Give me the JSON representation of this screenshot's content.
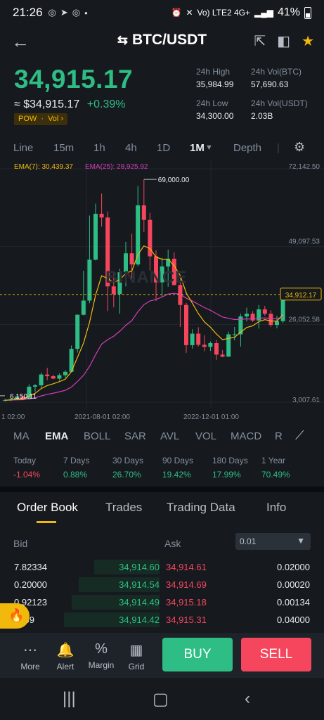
{
  "status_bar": {
    "time": "21:26",
    "battery": "41%",
    "network": "Vo) LTE2 4G+"
  },
  "header": {
    "pair": "BTC/USDT"
  },
  "ticker": {
    "last_price": "34,915.17",
    "approx": "≈ $34,915.17",
    "change": "+0.39%",
    "tag": "POW",
    "tag_vol": "Vol",
    "high_label": "24h High",
    "high_value": "35,984.99",
    "vol_btc_label": "24h Vol(BTC)",
    "vol_btc_value": "57,690.63",
    "low_label": "24h Low",
    "low_value": "34,300.00",
    "vol_usdt_label": "24h Vol(USDT)",
    "vol_usdt_value": "2.03B"
  },
  "intervals": [
    "Line",
    "15m",
    "1h",
    "4h",
    "1D",
    "1M",
    "Depth"
  ],
  "active_interval": "1M",
  "chart_data": {
    "type": "candlestick",
    "ema7_label": "EMA(7): 30,439.37",
    "ema25_label": "EMA(25): 28,925.92",
    "y_ticks": [
      "72,142.50",
      "49,097.53",
      "26,052.58",
      "3,007.61"
    ],
    "y_tick_values": [
      72142.5,
      49097.53,
      26052.58,
      3007.61
    ],
    "current_price_label": "34,912.17",
    "current_price_value": 34912.17,
    "max_label": "69,000.00",
    "max_value": 69000,
    "min_label": "6,150.11",
    "min_value": 6150.11,
    "x_labels": [
      "1 02:00",
      "2021-08-01 02:00",
      "2022-12-01 01:00"
    ],
    "watermark": "BINANCE",
    "candles": [
      [
        3500,
        3900,
        3300,
        3600
      ],
      [
        3600,
        4200,
        3400,
        3900
      ],
      [
        3900,
        5000,
        3600,
        4700
      ],
      [
        4700,
        4900,
        3700,
        3900
      ],
      [
        3900,
        8300,
        3800,
        7600
      ],
      [
        7600,
        8400,
        6150,
        8000
      ],
      [
        8000,
        11800,
        7200,
        11200
      ],
      [
        11200,
        13200,
        9500,
        10700
      ],
      [
        10700,
        11100,
        9800,
        10000
      ],
      [
        10000,
        11500,
        9400,
        11000
      ],
      [
        11000,
        12500,
        10200,
        12000
      ],
      [
        12000,
        19800,
        11900,
        18800
      ],
      [
        18800,
        29000,
        17700,
        28900
      ],
      [
        28900,
        41900,
        28700,
        33100
      ],
      [
        33100,
        58300,
        32300,
        45200
      ],
      [
        45200,
        61800,
        45000,
        58800
      ],
      [
        58800,
        64800,
        55000,
        57700
      ],
      [
        57700,
        59500,
        30000,
        37300
      ],
      [
        37300,
        41300,
        31100,
        35000
      ],
      [
        35000,
        42500,
        29200,
        41500
      ],
      [
        41500,
        50500,
        37300,
        47100
      ],
      [
        47100,
        52900,
        39600,
        43800
      ],
      [
        43800,
        67000,
        43300,
        61300
      ],
      [
        61300,
        69000,
        53400,
        57000
      ],
      [
        57000,
        59100,
        42000,
        46200
      ],
      [
        46200,
        48000,
        33000,
        38500
      ],
      [
        38500,
        45800,
        34300,
        43200
      ],
      [
        43200,
        48200,
        37200,
        45500
      ],
      [
        45500,
        47400,
        37600,
        37700
      ],
      [
        37700,
        40000,
        25300,
        31800
      ],
      [
        31800,
        32400,
        17600,
        19900
      ],
      [
        19900,
        24600,
        18900,
        23300
      ],
      [
        23300,
        25200,
        19500,
        20000
      ],
      [
        20000,
        22800,
        18100,
        19400
      ],
      [
        19400,
        21000,
        18200,
        20500
      ],
      [
        20500,
        21500,
        15500,
        17100
      ],
      [
        17100,
        18400,
        16300,
        16500
      ],
      [
        16500,
        23900,
        16400,
        23100
      ],
      [
        23100,
        25300,
        21300,
        23100
      ],
      [
        23100,
        29200,
        19500,
        28400
      ],
      [
        28400,
        31000,
        26900,
        29200
      ],
      [
        29200,
        30000,
        26800,
        27200
      ],
      [
        27200,
        31800,
        24800,
        30500
      ],
      [
        30500,
        31500,
        28600,
        29200
      ],
      [
        29200,
        30200,
        25300,
        25900
      ],
      [
        25900,
        28600,
        24900,
        27000
      ],
      [
        27000,
        35300,
        26500,
        34600
      ]
    ]
  },
  "indicators": [
    "MA",
    "EMA",
    "BOLL",
    "SAR",
    "AVL",
    "VOL",
    "MACD",
    "R"
  ],
  "active_indicator": "EMA",
  "performance": [
    {
      "label": "Today",
      "value": "-1.04%",
      "color": "#f6465d"
    },
    {
      "label": "7 Days",
      "value": "0.88%",
      "color": "#2ebd85"
    },
    {
      "label": "30 Days",
      "value": "26.70%",
      "color": "#2ebd85"
    },
    {
      "label": "90 Days",
      "value": "19.42%",
      "color": "#2ebd85"
    },
    {
      "label": "180 Days",
      "value": "17.99%",
      "color": "#2ebd85"
    },
    {
      "label": "1 Year",
      "value": "70.49%",
      "color": "#2ebd85"
    }
  ],
  "orderbook_tabs": [
    "Order Book",
    "Trades",
    "Trading Data",
    "Info"
  ],
  "orderbook": {
    "bid_label": "Bid",
    "ask_label": "Ask",
    "precision": "0.01",
    "rows": [
      {
        "bid_qty": "7.82334",
        "bid_price": "34,914.60",
        "ask_price": "34,914.61",
        "ask_qty": "0.02000",
        "depth": 0.58
      },
      {
        "bid_qty": "0.20000",
        "bid_price": "34,914.54",
        "ask_price": "34,914.69",
        "ask_qty": "0.00020",
        "depth": 0.72
      },
      {
        "bid_qty": "0.92123",
        "bid_price": "34,914.49",
        "ask_price": "34,915.18",
        "ask_qty": "0.00134",
        "depth": 0.78
      },
      {
        "bid_qty": "9859",
        "bid_price": "34,914.42",
        "ask_price": "34,915.31",
        "ask_qty": "0.04000",
        "depth": 0.85
      }
    ]
  },
  "bottom_nav": {
    "more": "More",
    "alert": "Alert",
    "margin": "Margin",
    "grid": "Grid",
    "buy": "BUY",
    "sell": "SELL"
  },
  "colors": {
    "up": "#2ebd85",
    "down": "#f6465d",
    "accent": "#f0b90b",
    "ema7": "#f0b90b",
    "ema25": "#d63cbe"
  }
}
